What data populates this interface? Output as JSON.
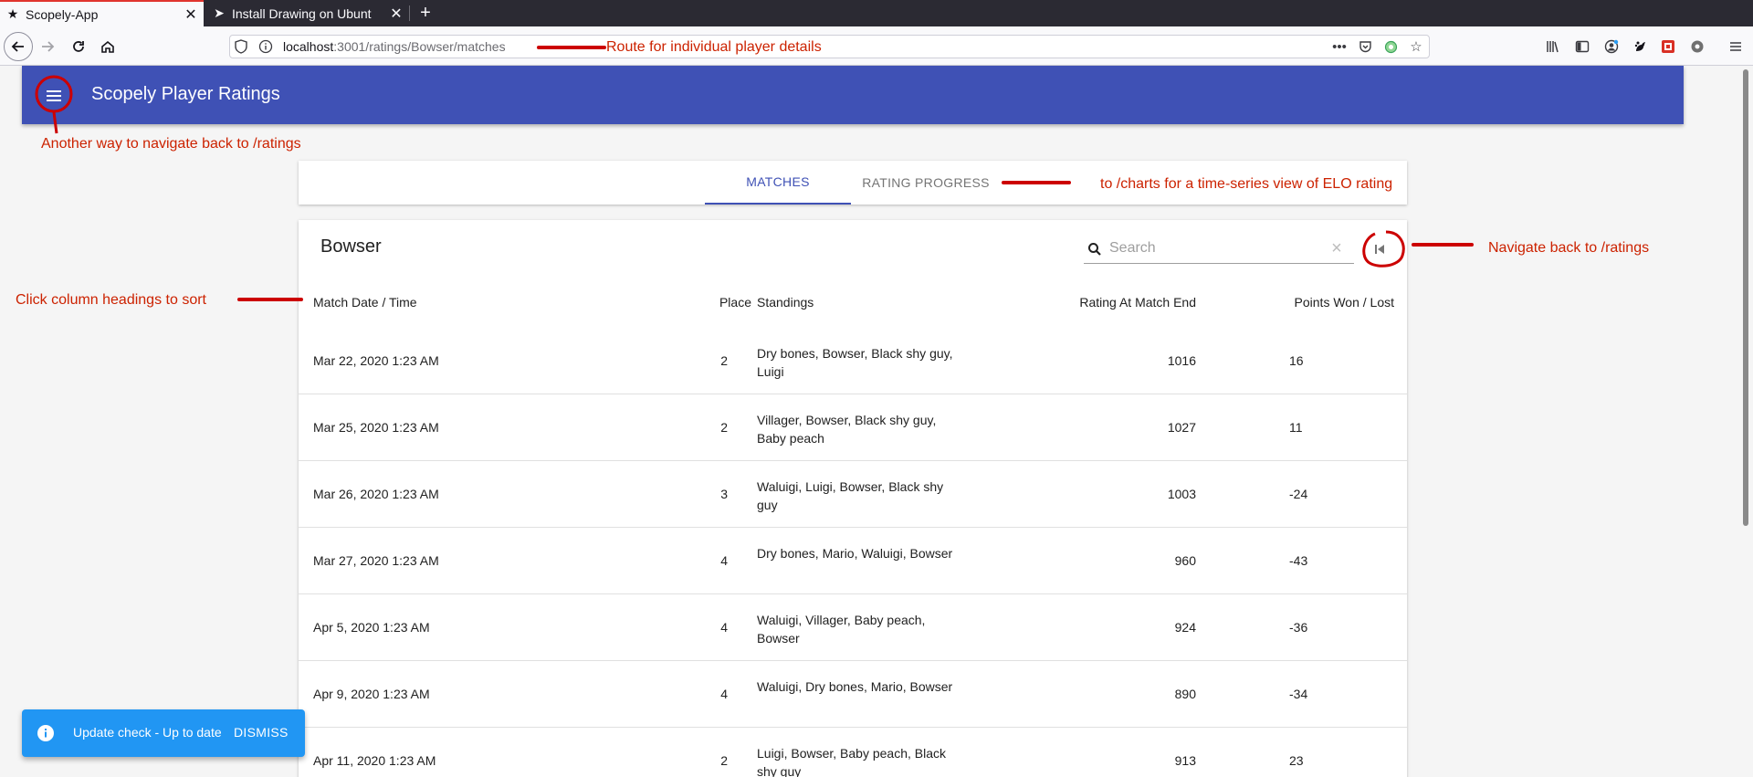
{
  "browser": {
    "tabs": [
      {
        "title": "Scopely-App",
        "icon": "star-icon",
        "active": true
      },
      {
        "title": "Install Drawing on Ubunt",
        "icon": "arrow-favicon-icon",
        "active": false
      }
    ],
    "url": {
      "host": "localhost",
      "rest": ":3001/ratings/Bowser/matches"
    }
  },
  "app": {
    "title": "Scopely Player Ratings",
    "primary_color": "#3f51b5",
    "tabs": [
      {
        "label": "MATCHES",
        "selected": true
      },
      {
        "label": "RATING PROGRESS",
        "selected": false
      }
    ]
  },
  "table": {
    "title": "Bowser",
    "search_placeholder": "Search",
    "columns": [
      "Match Date / Time",
      "Place",
      "Standings",
      "Rating At Match End",
      "Points Won / Lost"
    ],
    "rows": [
      {
        "date": "Mar 22, 2020 1:23 AM",
        "place": "2",
        "standings": "Dry bones, Bowser, Black shy guy, Luigi",
        "rating": "1016",
        "points": "16"
      },
      {
        "date": "Mar 25, 2020 1:23 AM",
        "place": "2",
        "standings": "Villager, Bowser, Black shy guy, Baby peach",
        "rating": "1027",
        "points": "11"
      },
      {
        "date": "Mar 26, 2020 1:23 AM",
        "place": "3",
        "standings": "Waluigi, Luigi, Bowser, Black shy guy",
        "rating": "1003",
        "points": "-24"
      },
      {
        "date": "Mar 27, 2020 1:23 AM",
        "place": "4",
        "standings": "Dry bones, Mario, Waluigi, Bowser",
        "rating": "960",
        "points": "-43"
      },
      {
        "date": "Apr 5, 2020 1:23 AM",
        "place": "4",
        "standings": "Waluigi, Villager, Baby peach, Bowser",
        "rating": "924",
        "points": "-36"
      },
      {
        "date": "Apr 9, 2020 1:23 AM",
        "place": "4",
        "standings": "Waluigi, Dry bones, Mario, Bowser",
        "rating": "890",
        "points": "-34"
      },
      {
        "date": "Apr 11, 2020 1:23 AM",
        "place": "2",
        "standings": "Luigi, Bowser, Baby peach, Black shy guy",
        "rating": "913",
        "points": "23"
      }
    ]
  },
  "snackbar": {
    "message": "Update check - Up to date",
    "action": "DISMISS",
    "color": "#2196f3"
  },
  "annotations": {
    "route": "Route for individual player details",
    "menu": "Another way to navigate back to /ratings",
    "charts": "to /charts for a time-series view of ELO rating",
    "nav_back": "Navigate back to /ratings",
    "sort": "Click column headings to sort",
    "color": "#cc0000"
  }
}
